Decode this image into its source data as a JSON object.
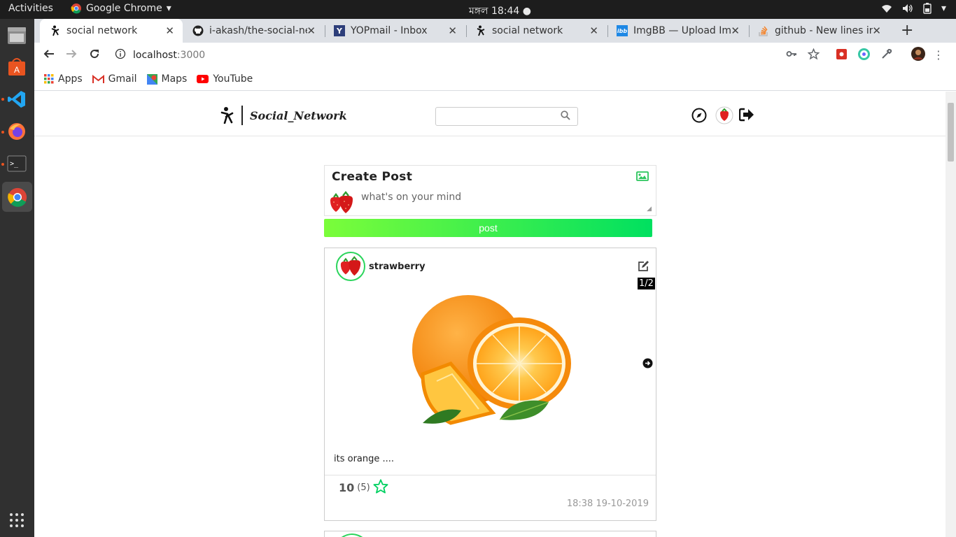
{
  "os": {
    "activities": "Activities",
    "app_name": "Google Chrome",
    "clock": "মঙ্গল 18:44 ●"
  },
  "tabs": [
    {
      "title": "social network",
      "active": true
    },
    {
      "title": "i-akash/the-social-ne",
      "active": false
    },
    {
      "title": "YOPmail - Inbox",
      "active": false
    },
    {
      "title": "social network",
      "active": false
    },
    {
      "title": "ImgBB — Upload Im",
      "active": false
    },
    {
      "title": "github - New lines in",
      "active": false
    }
  ],
  "toolbar": {
    "url_host": "localhost",
    "url_port": ":3000"
  },
  "bookmarks": [
    {
      "label": "Apps",
      "icon": "apps-grid-icon"
    },
    {
      "label": "Gmail",
      "icon": "gmail-icon"
    },
    {
      "label": "Maps",
      "icon": "maps-icon"
    },
    {
      "label": "YouTube",
      "icon": "youtube-icon"
    }
  ],
  "app": {
    "brand": "Social_Network",
    "search_placeholder": ""
  },
  "create_post": {
    "heading": "Create Post",
    "placeholder": "what's on your mind",
    "button": "post"
  },
  "post": {
    "username": "strawberry",
    "counter": "1/2",
    "caption": "its orange ....",
    "rating": "10",
    "rating_count": "(5)",
    "timestamp": "18:38 19-10-2019"
  },
  "colors": {
    "accent": "#00e060",
    "accent_start": "#7bfd3a",
    "chrome_tabstrip": "#dee1e6",
    "os_bar": "#1d1d1d",
    "dock": "#303030"
  }
}
